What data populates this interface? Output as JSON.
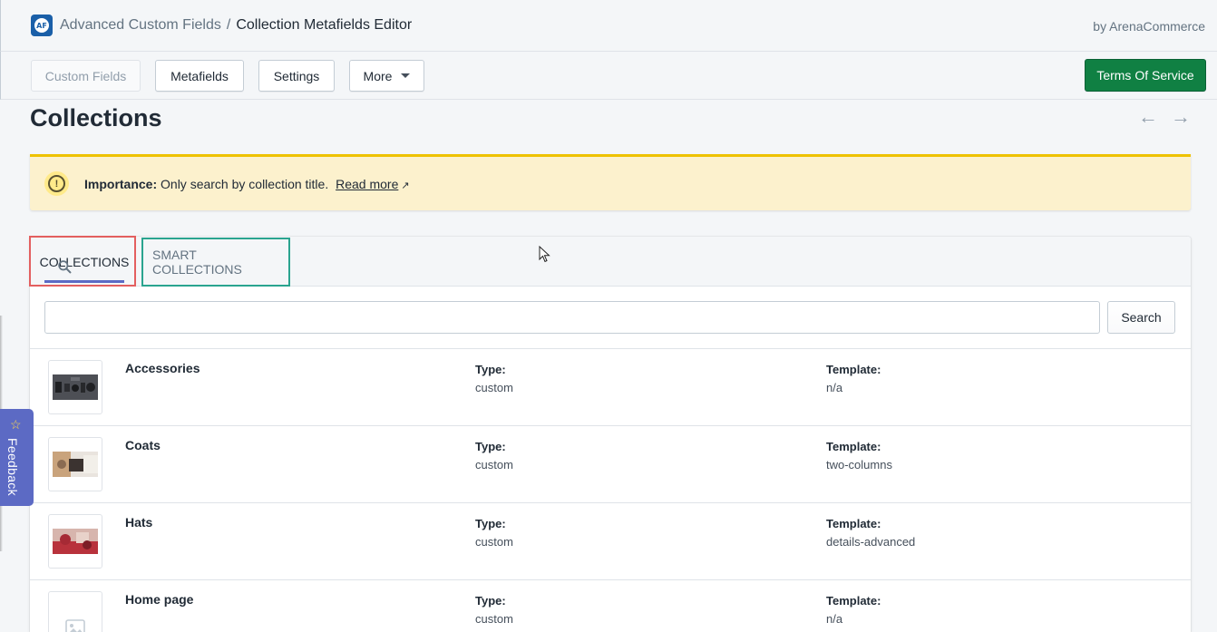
{
  "header": {
    "app_name": "Advanced Custom Fields",
    "separator": "/",
    "page_name": "Collection Metafields Editor",
    "by_text": "by ArenaCommerce"
  },
  "toolbar": {
    "custom_fields": "Custom Fields",
    "metafields": "Metafields",
    "settings": "Settings",
    "more": "More",
    "terms": "Terms Of Service"
  },
  "page": {
    "title": "Collections",
    "prev_arrow": "←",
    "next_arrow": "→"
  },
  "banner": {
    "label": "Importance:",
    "message": "Only search by collection title.",
    "link_text": "Read more"
  },
  "tabs": [
    {
      "label": "COLLECTIONS",
      "selected": true
    },
    {
      "label": "SMART COLLECTIONS",
      "selected": false
    }
  ],
  "search": {
    "placeholder": "",
    "value": "",
    "button_label": "Search"
  },
  "collections": [
    {
      "name": "Accessories",
      "type_label": "Type:",
      "type": "custom",
      "template_label": "Template:",
      "template": "n/a"
    },
    {
      "name": "Coats",
      "type_label": "Type:",
      "type": "custom",
      "template_label": "Template:",
      "template": "two-columns"
    },
    {
      "name": "Hats",
      "type_label": "Type:",
      "type": "custom",
      "template_label": "Template:",
      "template": "details-advanced"
    },
    {
      "name": "Home page",
      "type_label": "Type:",
      "type": "custom",
      "template_label": "Template:",
      "template": "n/a"
    }
  ],
  "feedback": {
    "label": "Feedback"
  },
  "colors": {
    "primary_green": "#108043",
    "tab_indicator": "#5c6ac4",
    "banner_bg": "#fcf1cd",
    "banner_border": "#eec200",
    "highlight_red": "#e35f5f",
    "highlight_green": "#2aa48f",
    "feedback_bg": "#5c6ac4"
  }
}
